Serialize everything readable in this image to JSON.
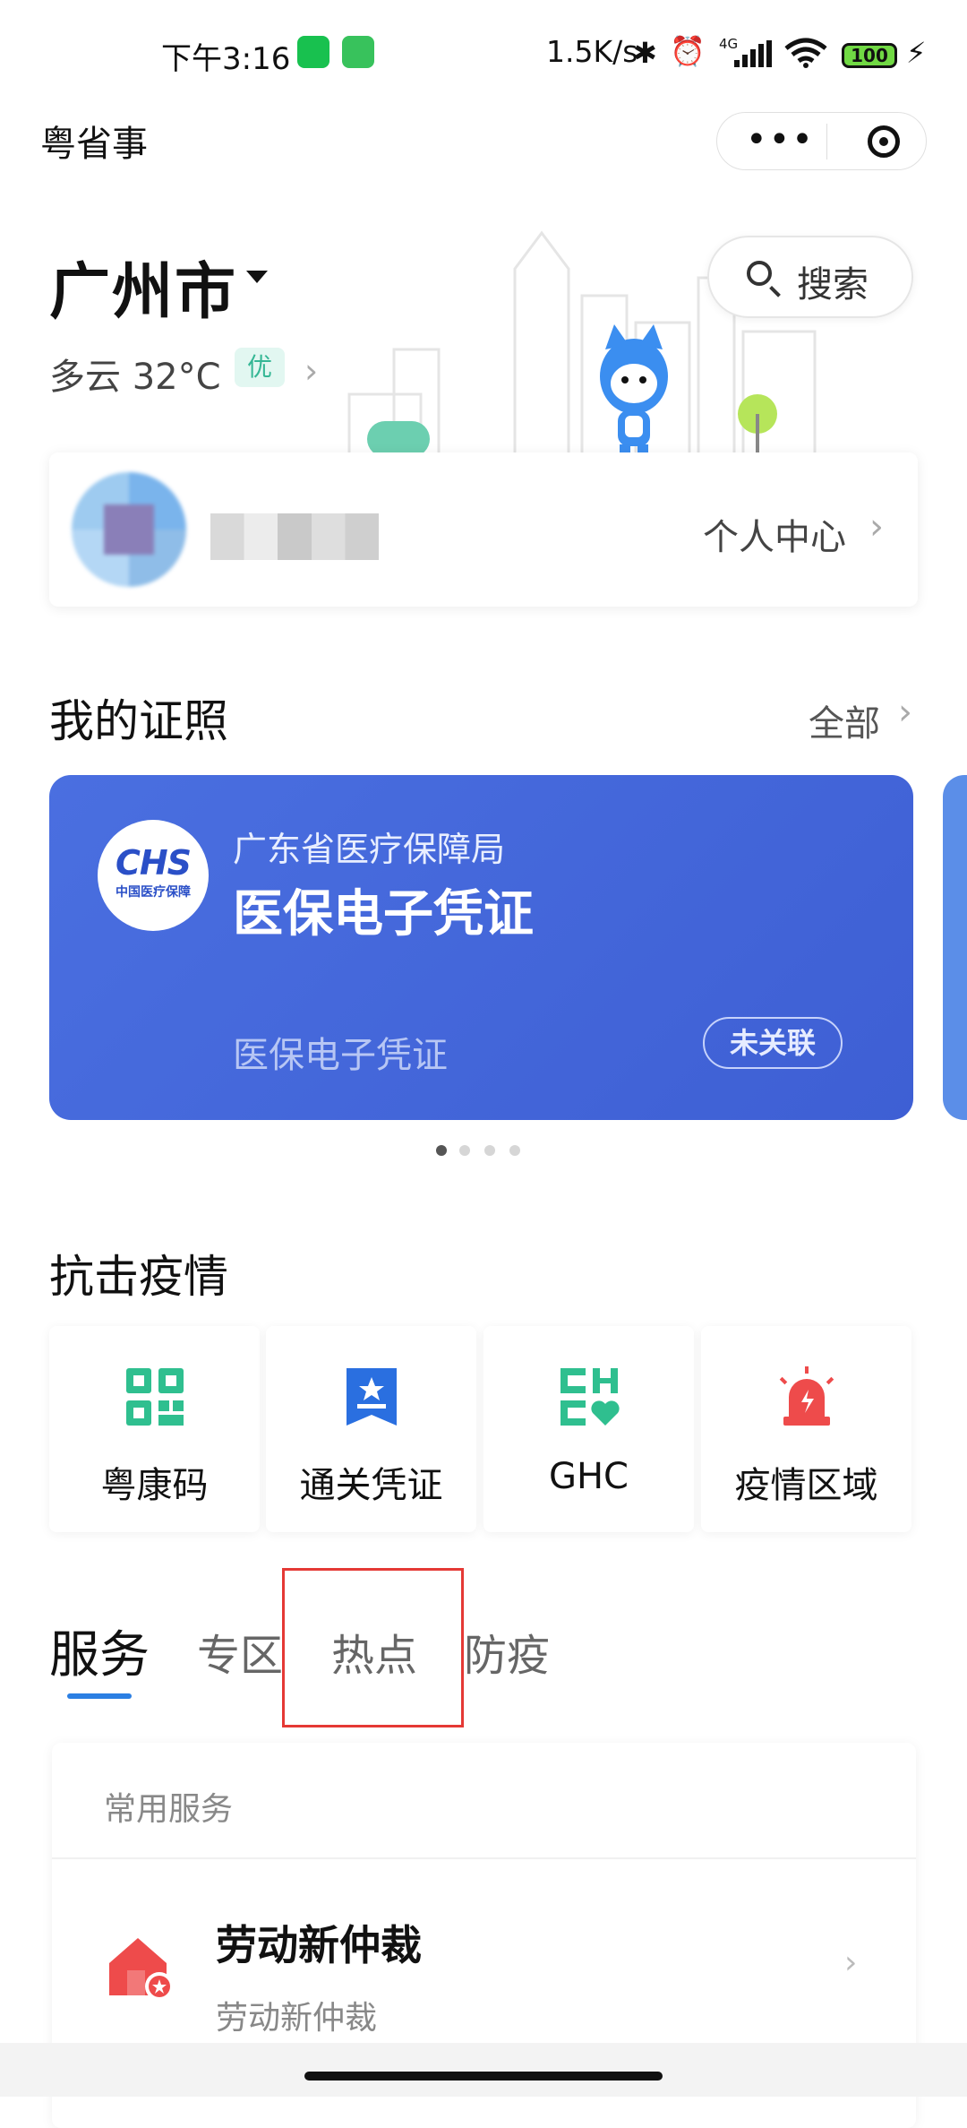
{
  "status_bar": {
    "time": "下午3:16",
    "network_speed": "1.5K/s",
    "signal_label": "4G",
    "battery": "100"
  },
  "mini_app": {
    "title": "粤省事",
    "more_label": "•••"
  },
  "location": {
    "city": "广州市",
    "weather": "多云 32°C",
    "aqi": "优"
  },
  "search": {
    "label": "搜索"
  },
  "profile": {
    "link_label": "个人中心"
  },
  "certificates": {
    "title": "我的证照",
    "all_label": "全部",
    "card": {
      "logo_text": "CHS",
      "logo_sub": "中国医疗保障",
      "issuer": "广东省医疗保障局",
      "name": "医保电子凭证",
      "footer": "医保电子凭证",
      "status": "未关联"
    },
    "pager_count": 4,
    "pager_active": 0
  },
  "epidemic": {
    "title": "抗击疫情",
    "tiles": [
      {
        "label": "粤康码",
        "icon": "qr-code-icon",
        "color": "#2fbf8f"
      },
      {
        "label": "通关凭证",
        "icon": "pass-ticket-icon",
        "color": "#2a6fe0"
      },
      {
        "label": "GHC",
        "icon": "ghc-heart-icon",
        "color": "#2fbf8f"
      },
      {
        "label": "疫情区域",
        "icon": "alarm-light-icon",
        "color": "#ee4b4b"
      }
    ]
  },
  "tabs": [
    {
      "label": "服务",
      "active": true
    },
    {
      "label": "专区",
      "active": false
    },
    {
      "label": "热点",
      "active": false
    },
    {
      "label": "防疫",
      "active": false
    }
  ],
  "services": {
    "heading": "常用服务",
    "items": [
      {
        "title": "劳动新仲裁",
        "subtitle": "劳动新仲裁",
        "icon": "house-badge-icon"
      }
    ]
  },
  "colors": {
    "accent": "#2b7fe3",
    "cert_card": "#4468dc",
    "aqi_good": "#35b795",
    "highlight": "#e53935"
  }
}
